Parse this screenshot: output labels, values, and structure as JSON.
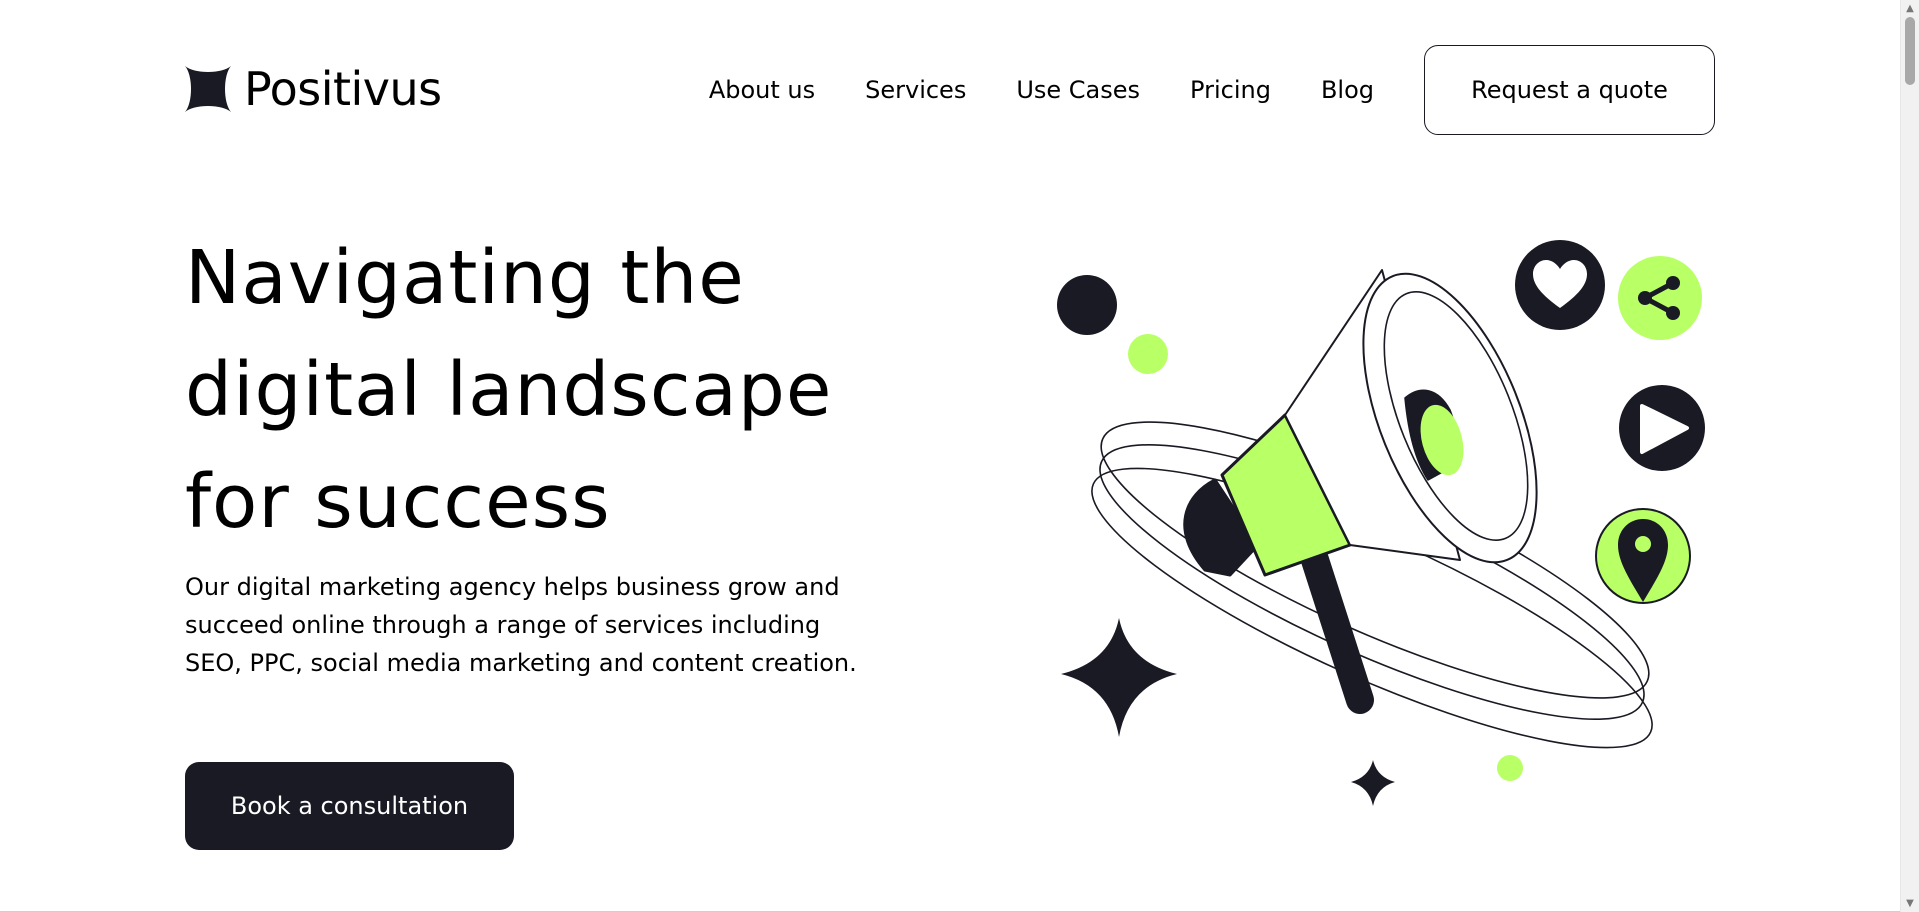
{
  "header": {
    "brand": "Positivus",
    "nav": [
      {
        "label": "About us"
      },
      {
        "label": "Services"
      },
      {
        "label": "Use Cases"
      },
      {
        "label": "Pricing"
      },
      {
        "label": "Blog"
      }
    ],
    "cta_label": "Request a quote"
  },
  "hero": {
    "title_lines": [
      "Navigating the",
      "digital landscape",
      "for success"
    ],
    "description": "Our digital marketing agency helps business grow and succeed online through a range of services including SEO, PPC, social media marketing and content creation.",
    "cta_label": "Book a consultation"
  },
  "illustration": {
    "icons": [
      "megaphone-icon",
      "heart-icon",
      "share-icon",
      "play-icon",
      "location-pin-icon",
      "sparkle-star-icon"
    ]
  },
  "colors": {
    "accent": "#B9FF66",
    "dark": "#191A23",
    "text": "#000000",
    "background": "#FFFFFF"
  }
}
